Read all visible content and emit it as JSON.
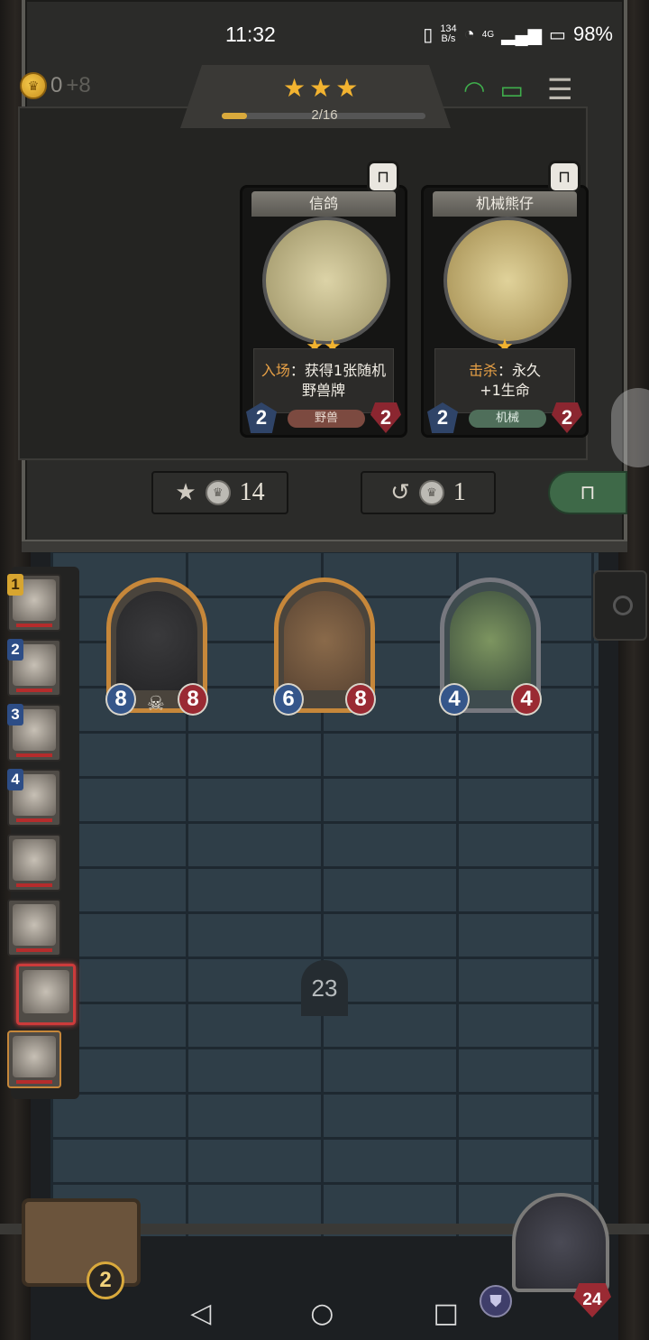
{
  "status_bar": {
    "time": "11:32",
    "net_speed_value": "134",
    "net_speed_unit": "B/s",
    "network": "4G",
    "battery_pct": "98%"
  },
  "shop": {
    "gold": "0",
    "gold_income": "+8",
    "tavern_stars": 3,
    "progress_text": "2/16",
    "progress": 0.125,
    "upgrade_cost": "14",
    "refresh_cost": "1",
    "cards": [
      {
        "name": "信鸽",
        "stars": 2,
        "keyword": "入场",
        "effect_line1": "：获得1张随机",
        "effect_line2": "野兽牌",
        "attack": "2",
        "health": "2",
        "tribe": "野兽"
      },
      {
        "name": "机械熊仔",
        "stars": 1,
        "keyword": "击杀",
        "effect_line1": "：永久",
        "effect_line2": "+1生命",
        "attack": "2",
        "health": "2",
        "tribe": "机械"
      }
    ]
  },
  "board": {
    "minions": [
      {
        "attack": "8",
        "health": "8",
        "has_deathrattle": true
      },
      {
        "attack": "6",
        "health": "8",
        "has_deathrattle": false
      },
      {
        "attack": "4",
        "health": "4",
        "has_deathrattle": false
      }
    ],
    "turn": "23"
  },
  "opponents": {
    "ranks": [
      "1",
      "2",
      "3",
      "4"
    ]
  },
  "player": {
    "chest_count": "2",
    "hero_health": "24"
  },
  "icons": {
    "star": "★",
    "lock": "🔒",
    "skull": "☠",
    "refresh": "↺",
    "upgrade": "★↑"
  },
  "colors": {
    "gold": "#f2b330",
    "attack": "#35568a",
    "health": "#9a2a33",
    "freeze": "#3e6948"
  }
}
